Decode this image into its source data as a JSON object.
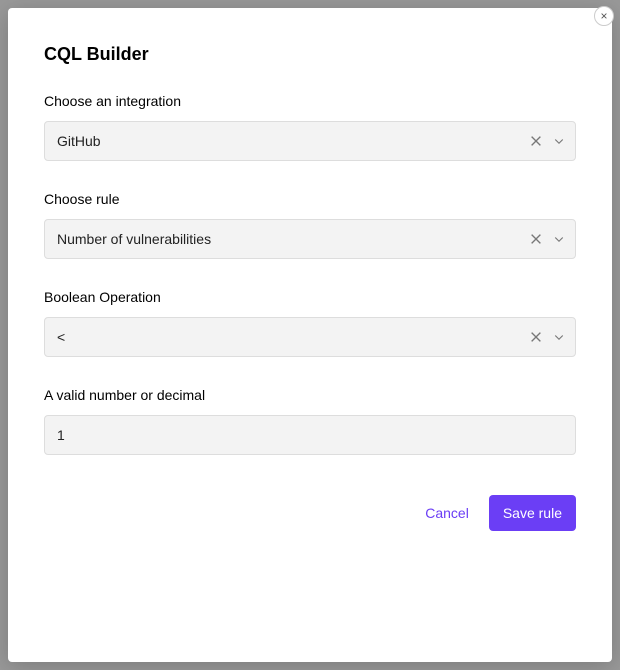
{
  "modal": {
    "title": "CQL Builder",
    "close_icon": "×"
  },
  "fields": {
    "integration": {
      "label": "Choose an integration",
      "value": "GitHub"
    },
    "rule": {
      "label": "Choose rule",
      "value": "Number of vulnerabilities"
    },
    "boolean_op": {
      "label": "Boolean Operation",
      "value": "<"
    },
    "number": {
      "label": "A valid number or decimal",
      "value": "1"
    }
  },
  "footer": {
    "cancel_label": "Cancel",
    "save_label": "Save rule"
  }
}
